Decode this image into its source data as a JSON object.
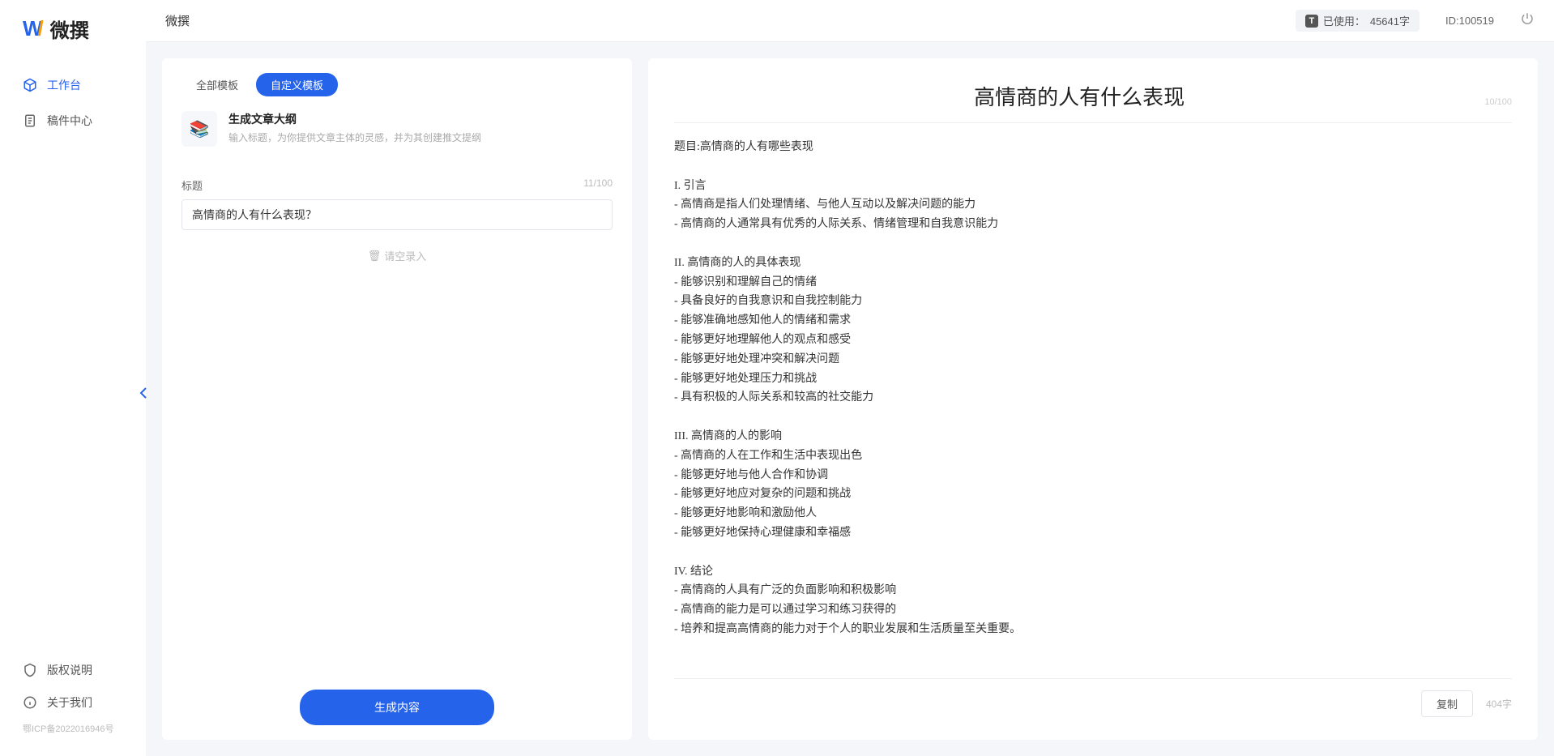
{
  "app": {
    "logo_text": "微撰",
    "breadcrumb": "微撰",
    "icp": "鄂ICP备2022016946号"
  },
  "sidebar": {
    "items": [
      {
        "label": "工作台",
        "icon": "cube-icon",
        "active": true
      },
      {
        "label": "稿件中心",
        "icon": "document-icon",
        "active": false
      }
    ],
    "footer_items": [
      {
        "label": "版权说明",
        "icon": "shield-icon"
      },
      {
        "label": "关于我们",
        "icon": "info-icon"
      }
    ]
  },
  "topbar": {
    "usage_label": "已使用：",
    "usage_value": "45641字",
    "userid": "ID:100519"
  },
  "left": {
    "tabs": [
      {
        "label": "全部模板",
        "active": false
      },
      {
        "label": "自定义模板",
        "active": true
      }
    ],
    "template": {
      "title": "生成文章大纲",
      "desc": "输入标题，为你提供文章主体的灵感，并为其创建推文提纲"
    },
    "field_label": "标题",
    "title_value": "高情商的人有什么表现？",
    "title_counter": "11/100",
    "placeholder_input": "请空录入",
    "generate_btn": "生成内容"
  },
  "doc": {
    "title": "高情商的人有什么表现",
    "title_counter": "10/100",
    "body": "题目:高情商的人有哪些表现\n\nI. 引言\n- 高情商是指人们处理情绪、与他人互动以及解决问题的能力\n- 高情商的人通常具有优秀的人际关系、情绪管理和自我意识能力\n\nII. 高情商的人的具体表现\n- 能够识别和理解自己的情绪\n- 具备良好的自我意识和自我控制能力\n- 能够准确地感知他人的情绪和需求\n- 能够更好地理解他人的观点和感受\n- 能够更好地处理冲突和解决问题\n- 能够更好地处理压力和挑战\n- 具有积极的人际关系和较高的社交能力\n\nIII. 高情商的人的影响\n- 高情商的人在工作和生活中表现出色\n- 能够更好地与他人合作和协调\n- 能够更好地应对复杂的问题和挑战\n- 能够更好地影响和激励他人\n- 能够更好地保持心理健康和幸福感\n\nIV. 结论\n- 高情商的人具有广泛的负面影响和积极影响\n- 高情商的能力是可以通过学习和练习获得的\n- 培养和提高高情商的能力对于个人的职业发展和生活质量至关重要。",
    "copy_btn": "复制",
    "word_count": "404字"
  }
}
